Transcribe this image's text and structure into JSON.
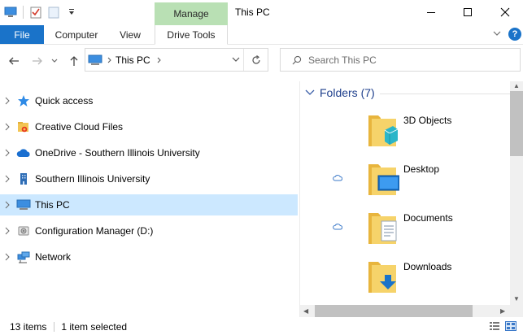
{
  "window": {
    "title": "This PC",
    "context_tab": "Manage",
    "controls": {
      "minimize": "minimize-icon",
      "maximize": "maximize-icon",
      "close": "close-icon"
    }
  },
  "ribbon": {
    "tabs": [
      {
        "label": "File"
      },
      {
        "label": "Computer"
      },
      {
        "label": "View"
      },
      {
        "label": "Drive Tools"
      }
    ]
  },
  "address": {
    "crumbs": [
      "This PC"
    ],
    "search_placeholder": "Search This PC"
  },
  "nav_pane": {
    "items": [
      {
        "label": "Quick access",
        "icon": "star-icon",
        "selected": false
      },
      {
        "label": "Creative Cloud Files",
        "icon": "creative-cloud-folder-icon",
        "selected": false
      },
      {
        "label": "OneDrive - Southern Illinois University",
        "icon": "onedrive-cloud-icon",
        "selected": false
      },
      {
        "label": "Southern Illinois University",
        "icon": "building-icon",
        "selected": false
      },
      {
        "label": "This PC",
        "icon": "computer-icon",
        "selected": true
      },
      {
        "label": "Configuration Manager (D:)",
        "icon": "drive-icon",
        "selected": false
      },
      {
        "label": "Network",
        "icon": "network-icon",
        "selected": false
      }
    ]
  },
  "content": {
    "group_label": "Folders (7)",
    "folders": [
      {
        "name": "3D Objects",
        "icon": "3d-objects-folder-icon",
        "cloud": false
      },
      {
        "name": "Desktop",
        "icon": "desktop-folder-icon",
        "cloud": true
      },
      {
        "name": "Documents",
        "icon": "documents-folder-icon",
        "cloud": true
      },
      {
        "name": "Downloads",
        "icon": "downloads-folder-icon",
        "cloud": false
      }
    ]
  },
  "status": {
    "item_count": "13 items",
    "selection": "1 item selected"
  },
  "colors": {
    "file_tab": "#1a73c9",
    "manage_tab": "#b9e0b4",
    "selection": "#cce8ff",
    "group_header": "#1e3f8c"
  }
}
